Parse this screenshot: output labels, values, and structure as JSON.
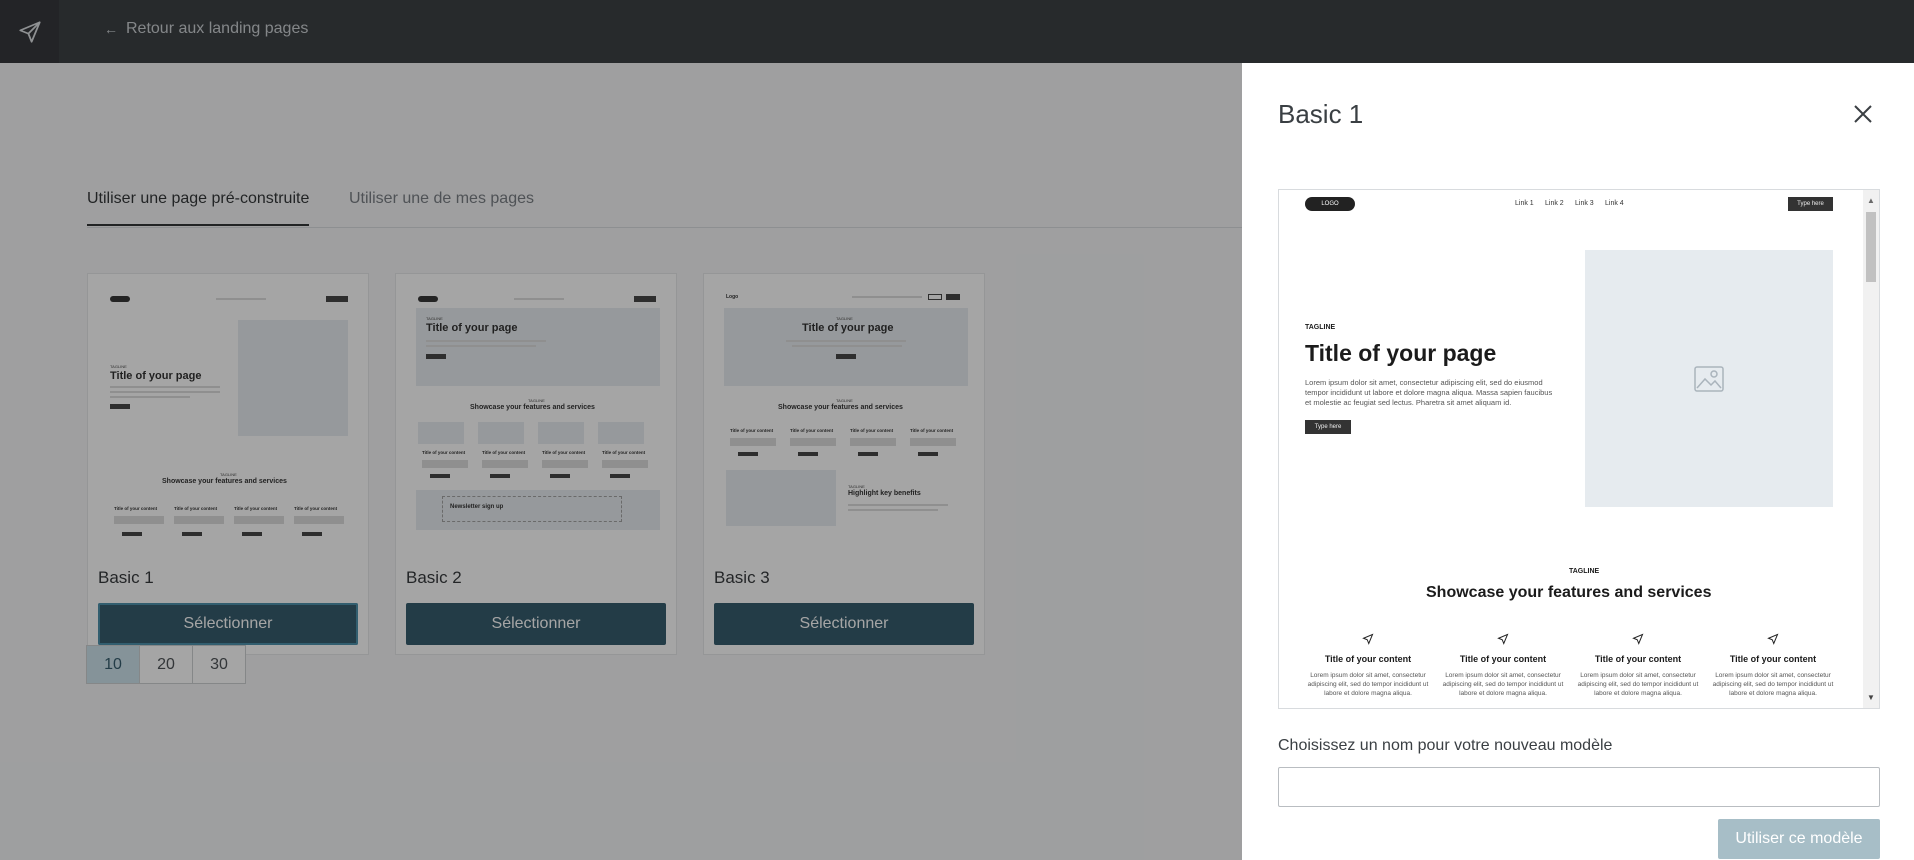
{
  "topbar": {
    "logo_icon": "paper-plane-icon",
    "back_label": "Retour aux landing pages",
    "back_icon": "arrow-left-icon"
  },
  "tabs": [
    {
      "label": "Utiliser une page pré-construite",
      "active": true
    },
    {
      "label": "Utiliser une de mes pages",
      "active": false
    }
  ],
  "templates": [
    {
      "name": "Basic 1",
      "button": "Sélectionner"
    },
    {
      "name": "Basic 2",
      "button": "Sélectionner"
    },
    {
      "name": "Basic 3",
      "button": "Sélectionner"
    }
  ],
  "thumbs": {
    "basic1": {
      "tagline": "TAGLINE",
      "title": "Title of your page",
      "section_tagline": "TAGLINE",
      "section_title": "Showcase your features and services",
      "feature_title": "Title of your content"
    },
    "basic2": {
      "tagline": "TAGLINE",
      "title": "Title of your page",
      "section_tagline": "TAGLINE",
      "section_title": "Showcase your features and services",
      "feature_title": "Title of your content",
      "newsletter": "Newsletter sign up"
    },
    "basic3": {
      "logo": "Logo",
      "tagline": "TAGLINE",
      "title": "Title of your page",
      "section_tagline": "TAGLINE",
      "section_title": "Showcase your features and services",
      "feature_title": "Title of your content",
      "highlight_tagline": "TAGLINE",
      "highlight": "Highlight key benefits"
    }
  },
  "pagination": {
    "sizes": [
      "10",
      "20",
      "30"
    ],
    "active": "10"
  },
  "panel": {
    "title": "Basic 1",
    "close_icon": "close-icon",
    "preview": {
      "logo": "LOGO",
      "links": [
        "Link 1",
        "Link 2",
        "Link 3",
        "Link 4"
      ],
      "cta": "Type here",
      "tagline": "TAGLINE",
      "title": "Title of your page",
      "paragraph": "Lorem ipsum dolor sit amet, consectetur adipiscing elit, sed do eiusmod tempor incididunt ut labore et dolore magna aliqua. Massa sapien faucibus et molestie ac feugiat sed lectus. Pharetra sit amet aliquam id.",
      "button": "Type here",
      "section_tagline": "TAGLINE",
      "section_title": "Showcase your features and services",
      "features": [
        {
          "title": "Title of your content",
          "text": "Lorem ipsum dolor sit amet, consectetur adipiscing elit, sed do tempor incididunt ut labore et dolore magna aliqua."
        },
        {
          "title": "Title of your content",
          "text": "Lorem ipsum dolor sit amet, consectetur adipiscing elit, sed do tempor incididunt ut labore et dolore magna aliqua."
        },
        {
          "title": "Title of your content",
          "text": "Lorem ipsum dolor sit amet, consectetur adipiscing elit, sed do tempor incididunt ut labore et dolore magna aliqua."
        },
        {
          "title": "Title of your content",
          "text": "Lorem ipsum dolor sit amet, consectetur adipiscing elit, sed do tempor incididunt ut labore et dolore magna aliqua."
        }
      ]
    },
    "name_label": "Choisissez un nom pour votre nouveau modèle",
    "name_value": "",
    "use_button": "Utiliser ce modèle"
  },
  "colors": {
    "topbar": "#272b30",
    "primary_button": "#1f4b5e",
    "disabled_button": "#a7bec7",
    "pager_active": "#c8e0ea"
  }
}
